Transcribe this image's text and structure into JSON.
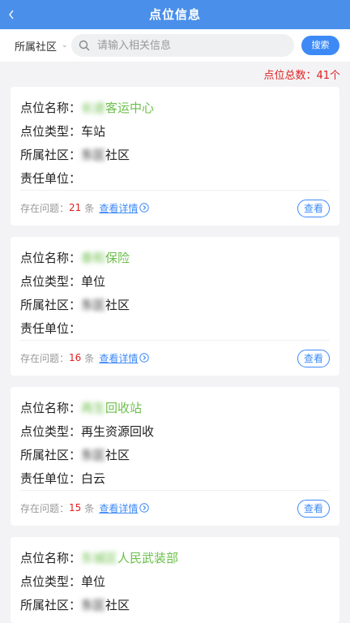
{
  "header": {
    "title": "点位信息"
  },
  "filter": {
    "community": "所属社区",
    "search_placeholder": "请输入相关信息",
    "search_label": "搜索"
  },
  "total": "点位总数：41个",
  "labels": {
    "name": "点位名称：",
    "type": "点位类型：",
    "community": "所属社区：",
    "unit": "责任单位：",
    "issues": "存在问题：",
    "tiao": "条",
    "detail": "查看详情",
    "view": "查看"
  },
  "cards": [
    {
      "name_blur": "长途",
      "name_visible": "客运中心",
      "type": "车站",
      "community_blur": "东区",
      "community_visible": "社区",
      "unit": "",
      "issues": "21"
    },
    {
      "name_blur": "泰和",
      "name_visible": "保险",
      "type": "单位",
      "community_blur": "东区",
      "community_visible": "社区",
      "unit": "",
      "issues": "16"
    },
    {
      "name_blur": "再生",
      "name_visible": "回收站",
      "type": "再生资源回收",
      "community_blur": "东区",
      "community_visible": "社区",
      "unit": "白云",
      "issues": "15"
    },
    {
      "name_blur": "东城区",
      "name_visible": "人民武装部",
      "type": "单位",
      "community_blur": "东区",
      "community_visible": "社区"
    }
  ]
}
